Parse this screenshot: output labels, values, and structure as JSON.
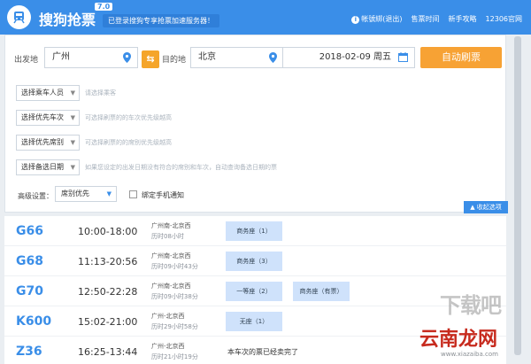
{
  "header": {
    "app_title": "搜狗抢票",
    "version": "7.0",
    "slogan": "已登录搜狗专享抢票加速服务器！",
    "nav": [
      "帐號綁(退出)",
      "售票时间",
      "新手攻略",
      "12306官网"
    ]
  },
  "search": {
    "from_label": "出发地",
    "from_value": "广州",
    "swap_icon": "⇆",
    "to_label": "目的地",
    "to_value": "北京",
    "date_value": "2018-02-09  周五",
    "auto_button": "自动刷票"
  },
  "options": [
    {
      "label": "选择乘车人员",
      "hint": "请选择乘客"
    },
    {
      "label": "选择优先车次",
      "hint": "可选择刷票的的车次优先级越高"
    },
    {
      "label": "选择优先席别",
      "hint": "可选择刷票的的席别优先级越高"
    },
    {
      "label": "选择备选日期",
      "hint": "如果您设定的出发日期没有符合的席别和车次，自动查询备选日期的票"
    }
  ],
  "advanced": {
    "label": "高级设置：",
    "select_value": "席别优先",
    "checkbox_label": "绑定手机通知",
    "collapse_button": "收起选项"
  },
  "trains": [
    {
      "no": "G66",
      "time": "10:00-18:00",
      "route": "广州南-北京西",
      "duration": "历时08小时",
      "seats": [
        "商务座（1）"
      ]
    },
    {
      "no": "G68",
      "time": "11:13-20:56",
      "route": "广州南-北京西",
      "duration": "历时09小时43分",
      "seats": [
        "商务座（3）"
      ]
    },
    {
      "no": "G70",
      "time": "12:50-22:28",
      "route": "广州南-北京西",
      "duration": "历时09小时38分",
      "seats": [
        "一等座（2）",
        "商务座（有票）"
      ]
    },
    {
      "no": "K600",
      "time": "15:02-21:00",
      "route": "广州-北京西",
      "duration": "历时29小时58分",
      "seats": [
        "无座（1）"
      ]
    },
    {
      "no": "Z36",
      "time": "16:25-13:44",
      "route": "广州-北京西",
      "duration": "历时21小时19分",
      "seats": [],
      "status": "本车次的票已经卖完了"
    }
  ],
  "watermarks": {
    "line1": "下载吧",
    "line2": "云南龙网",
    "line3": "www.xiazaiba.com"
  },
  "colors": {
    "header_blue": "#3a8ee8",
    "accent_orange": "#f7a234",
    "seat_tag_blue": "#cfe2fb"
  }
}
